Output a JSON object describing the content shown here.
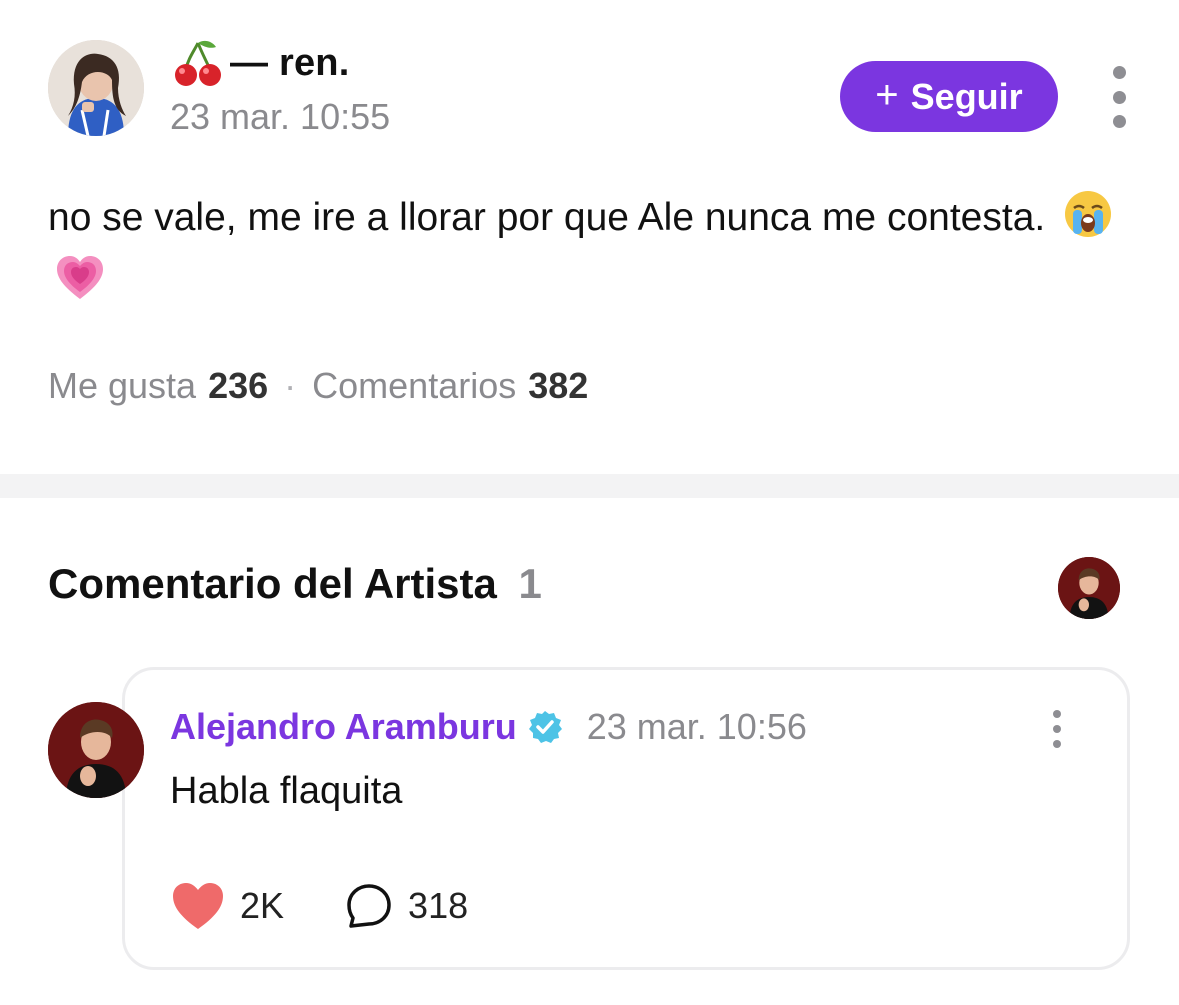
{
  "post": {
    "author_name": "— ren.",
    "author_emoji": "cherry-icon",
    "timestamp": "23 mar. 10:55",
    "follow_label": "Seguir",
    "body_text": "no se vale, me ire a llorar por que Ale nunca me contesta.",
    "emojis": [
      "loudly-crying-face-icon",
      "growing-heart-icon"
    ],
    "stats": {
      "likes_label": "Me gusta",
      "likes_count": "236",
      "separator": "·",
      "comments_label": "Comentarios",
      "comments_count": "382"
    }
  },
  "artist_section": {
    "title": "Comentario del Artista",
    "count": "1"
  },
  "artist_comment": {
    "author_name": "Alejandro Aramburu",
    "verified": true,
    "timestamp": "23 mar. 10:56",
    "text": "Habla flaquita",
    "likes": "2K",
    "replies": "318"
  },
  "colors": {
    "accent": "#7b36e0",
    "heart": "#ef6a6a",
    "verified": "#4dc3e6",
    "muted": "#8a8a8e"
  }
}
